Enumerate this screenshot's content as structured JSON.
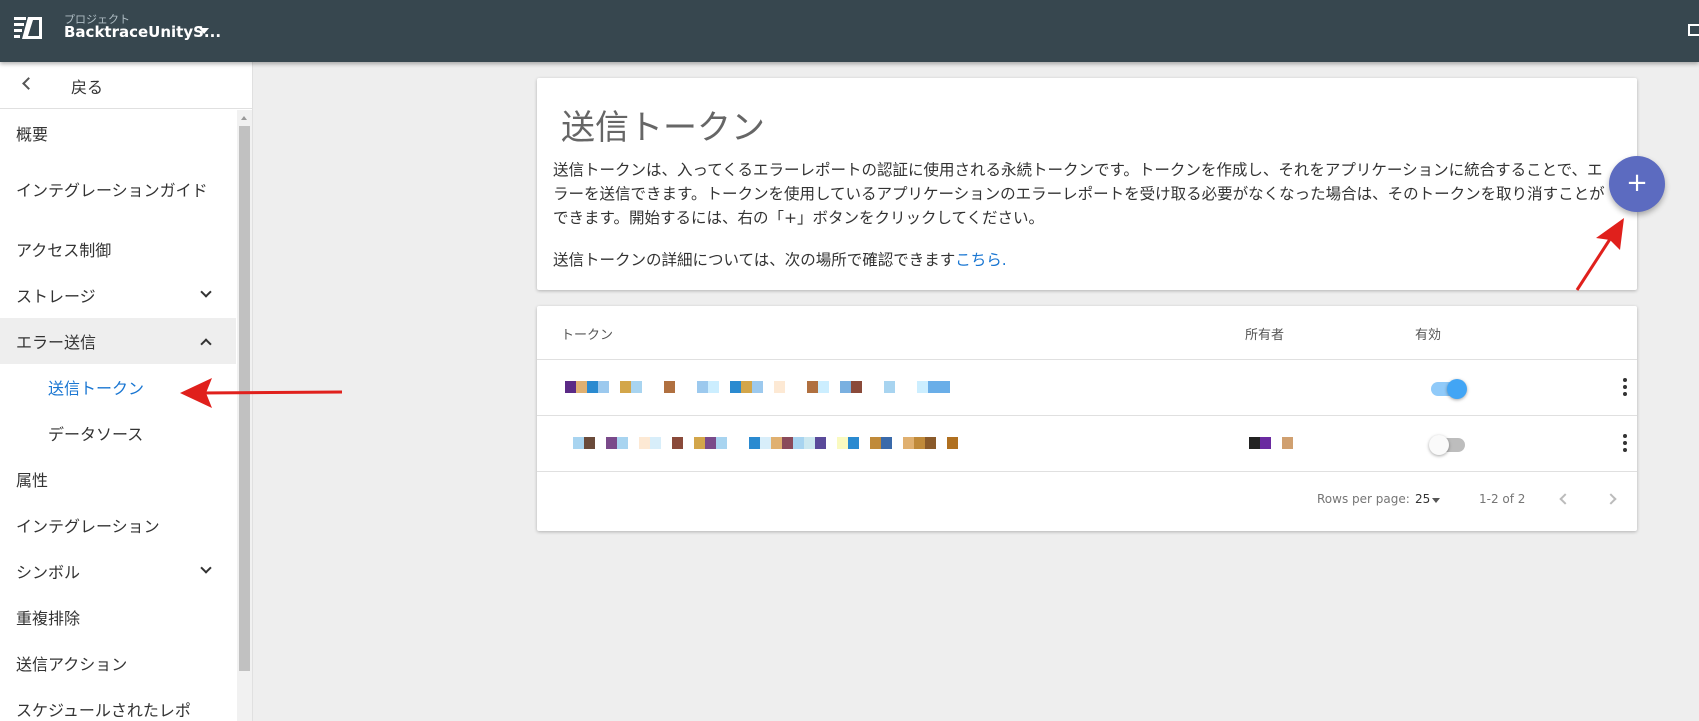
{
  "topbar": {
    "project_label": "プロジェクト",
    "project_name": "BacktraceUnityS..."
  },
  "sidebar": {
    "back_label": "戻る",
    "items": [
      {
        "label": "概要"
      },
      {
        "label": "インテグレーションガイド"
      },
      {
        "label": "アクセス制御"
      },
      {
        "label": "ストレージ"
      },
      {
        "label": "エラー送信"
      },
      {
        "label": "送信トークン"
      },
      {
        "label": "データソース"
      },
      {
        "label": "属性"
      },
      {
        "label": "インテグレーション"
      },
      {
        "label": "シンボル"
      },
      {
        "label": "重複排除"
      },
      {
        "label": "送信アクション"
      },
      {
        "label": "スケジュールされたレポ"
      }
    ]
  },
  "main": {
    "title": "送信トークン",
    "description": "送信トークンは、入ってくるエラーレポートの認証に使用される永続トークンです。トークンを作成し、それをアプリケーションに統合することで、エラーを送信できます。トークンを使用しているアプリケーションのエラーレポートを受け取る必要がなくなった場合は、そのトークンを取り消すことができます。開始するには、右の「+」ボタンをクリックしてください。",
    "more_text": "送信トークンの詳細については、次の場所で確認できます",
    "more_link": "こちら.",
    "fab_label": "+"
  },
  "table": {
    "columns": [
      "トークン",
      "所有者",
      "有効"
    ],
    "rows": [
      {
        "enabled": true
      },
      {
        "enabled": false
      }
    ],
    "footer": {
      "rows_per_page_label": "Rows per page:",
      "rows_per_page_value": "25",
      "range": "1-2 of 2"
    }
  },
  "colors": {
    "topbar": "#37474f",
    "accent": "#1976d2",
    "fab": "#5c6bc0",
    "annotation_arrow": "#e0201c"
  }
}
